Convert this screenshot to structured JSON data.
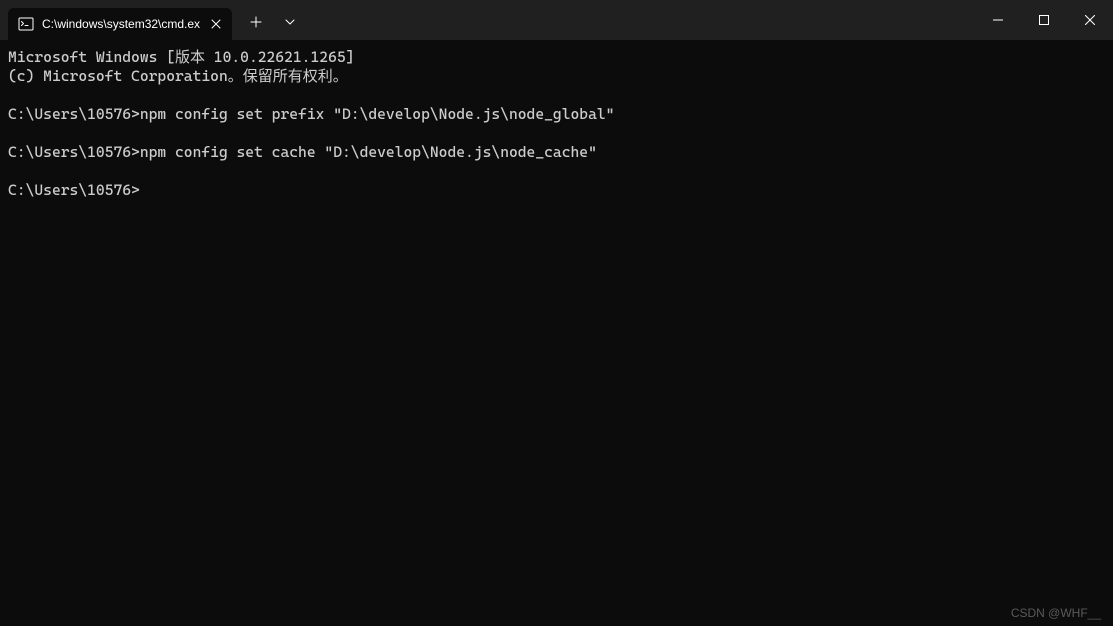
{
  "tab": {
    "title": "C:\\windows\\system32\\cmd.ex"
  },
  "terminal": {
    "lines": [
      "Microsoft Windows [版本 10.0.22621.1265]",
      "(c) Microsoft Corporation。保留所有权利。",
      "",
      "C:\\Users\\10576>npm config set prefix \"D:\\develop\\Node.js\\node_global\"",
      "",
      "C:\\Users\\10576>npm config set cache \"D:\\develop\\Node.js\\node_cache\"",
      "",
      "C:\\Users\\10576>"
    ]
  },
  "watermark": "CSDN @WHF__"
}
